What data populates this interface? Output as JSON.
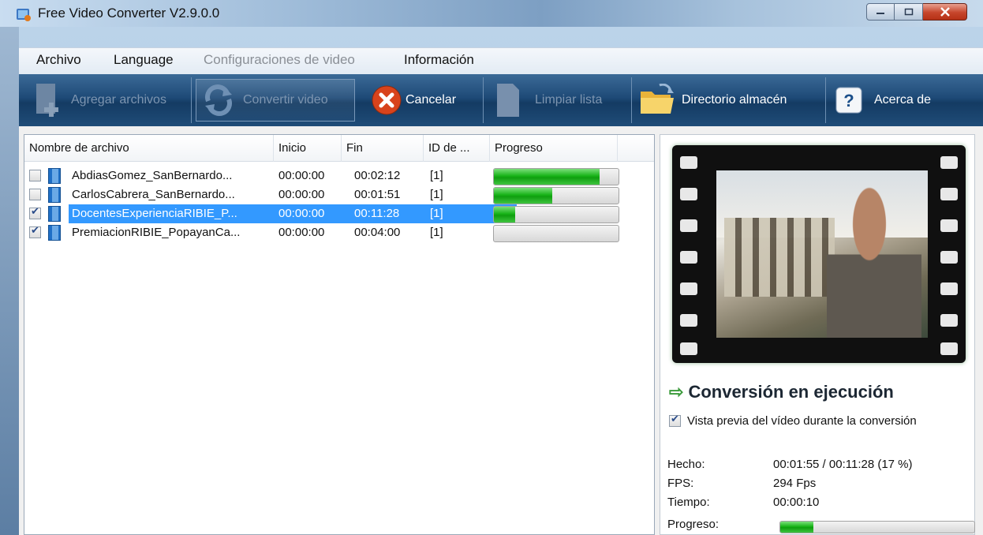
{
  "window": {
    "title": "Free Video Converter V2.9.0.0"
  },
  "menu": {
    "items": [
      {
        "label": "Archivo",
        "enabled": true
      },
      {
        "label": "Language",
        "enabled": true
      },
      {
        "label": "Configuraciones de video",
        "enabled": false
      },
      {
        "label": "Información",
        "enabled": true
      }
    ]
  },
  "toolbar": {
    "add_files": "Agregar archivos",
    "convert": "Convertir video",
    "cancel": "Cancelar",
    "clear_list": "Limpiar lista",
    "output_dir": "Directorio almacén",
    "about": "Acerca de"
  },
  "file_list": {
    "columns": [
      "Nombre de archivo",
      "Inicio",
      "Fin",
      "ID de ...",
      "Progreso"
    ],
    "rows": [
      {
        "name": "AbdiasGomez_SanBernardo...",
        "start": "00:00:00",
        "end": "00:02:12",
        "id": "[1]",
        "checked": false,
        "selected": false,
        "progress": 0.85
      },
      {
        "name": "CarlosCabrera_SanBernardo...",
        "start": "00:00:00",
        "end": "00:01:51",
        "id": "[1]",
        "checked": false,
        "selected": false,
        "progress": 0.47
      },
      {
        "name": "DocentesExperienciaRIBIE_P...",
        "start": "00:00:00",
        "end": "00:11:28",
        "id": "[1]",
        "checked": true,
        "selected": true,
        "progress": 0.17
      },
      {
        "name": "PremiacionRIBIE_PopayanCa...",
        "start": "00:00:00",
        "end": "00:04:00",
        "id": "[1]",
        "checked": true,
        "selected": false,
        "progress": 0
      }
    ]
  },
  "status": {
    "title": "Conversión en ejecución",
    "preview_label": "Vista previa del vídeo durante la conversión",
    "preview_checked": true,
    "done_label": "Hecho:",
    "done_value": "00:01:55 / 00:11:28  (17 %)",
    "fps_label": "FPS:",
    "fps_value": "294 Fps",
    "time_label": "Tiempo:",
    "time_value": "00:00:10",
    "progress_label": "Progreso:",
    "progress": 0.17
  },
  "colors": {
    "selection": "#3399ff",
    "progress_green": "#17b317",
    "toolbar_blue": "#1e4a77"
  }
}
